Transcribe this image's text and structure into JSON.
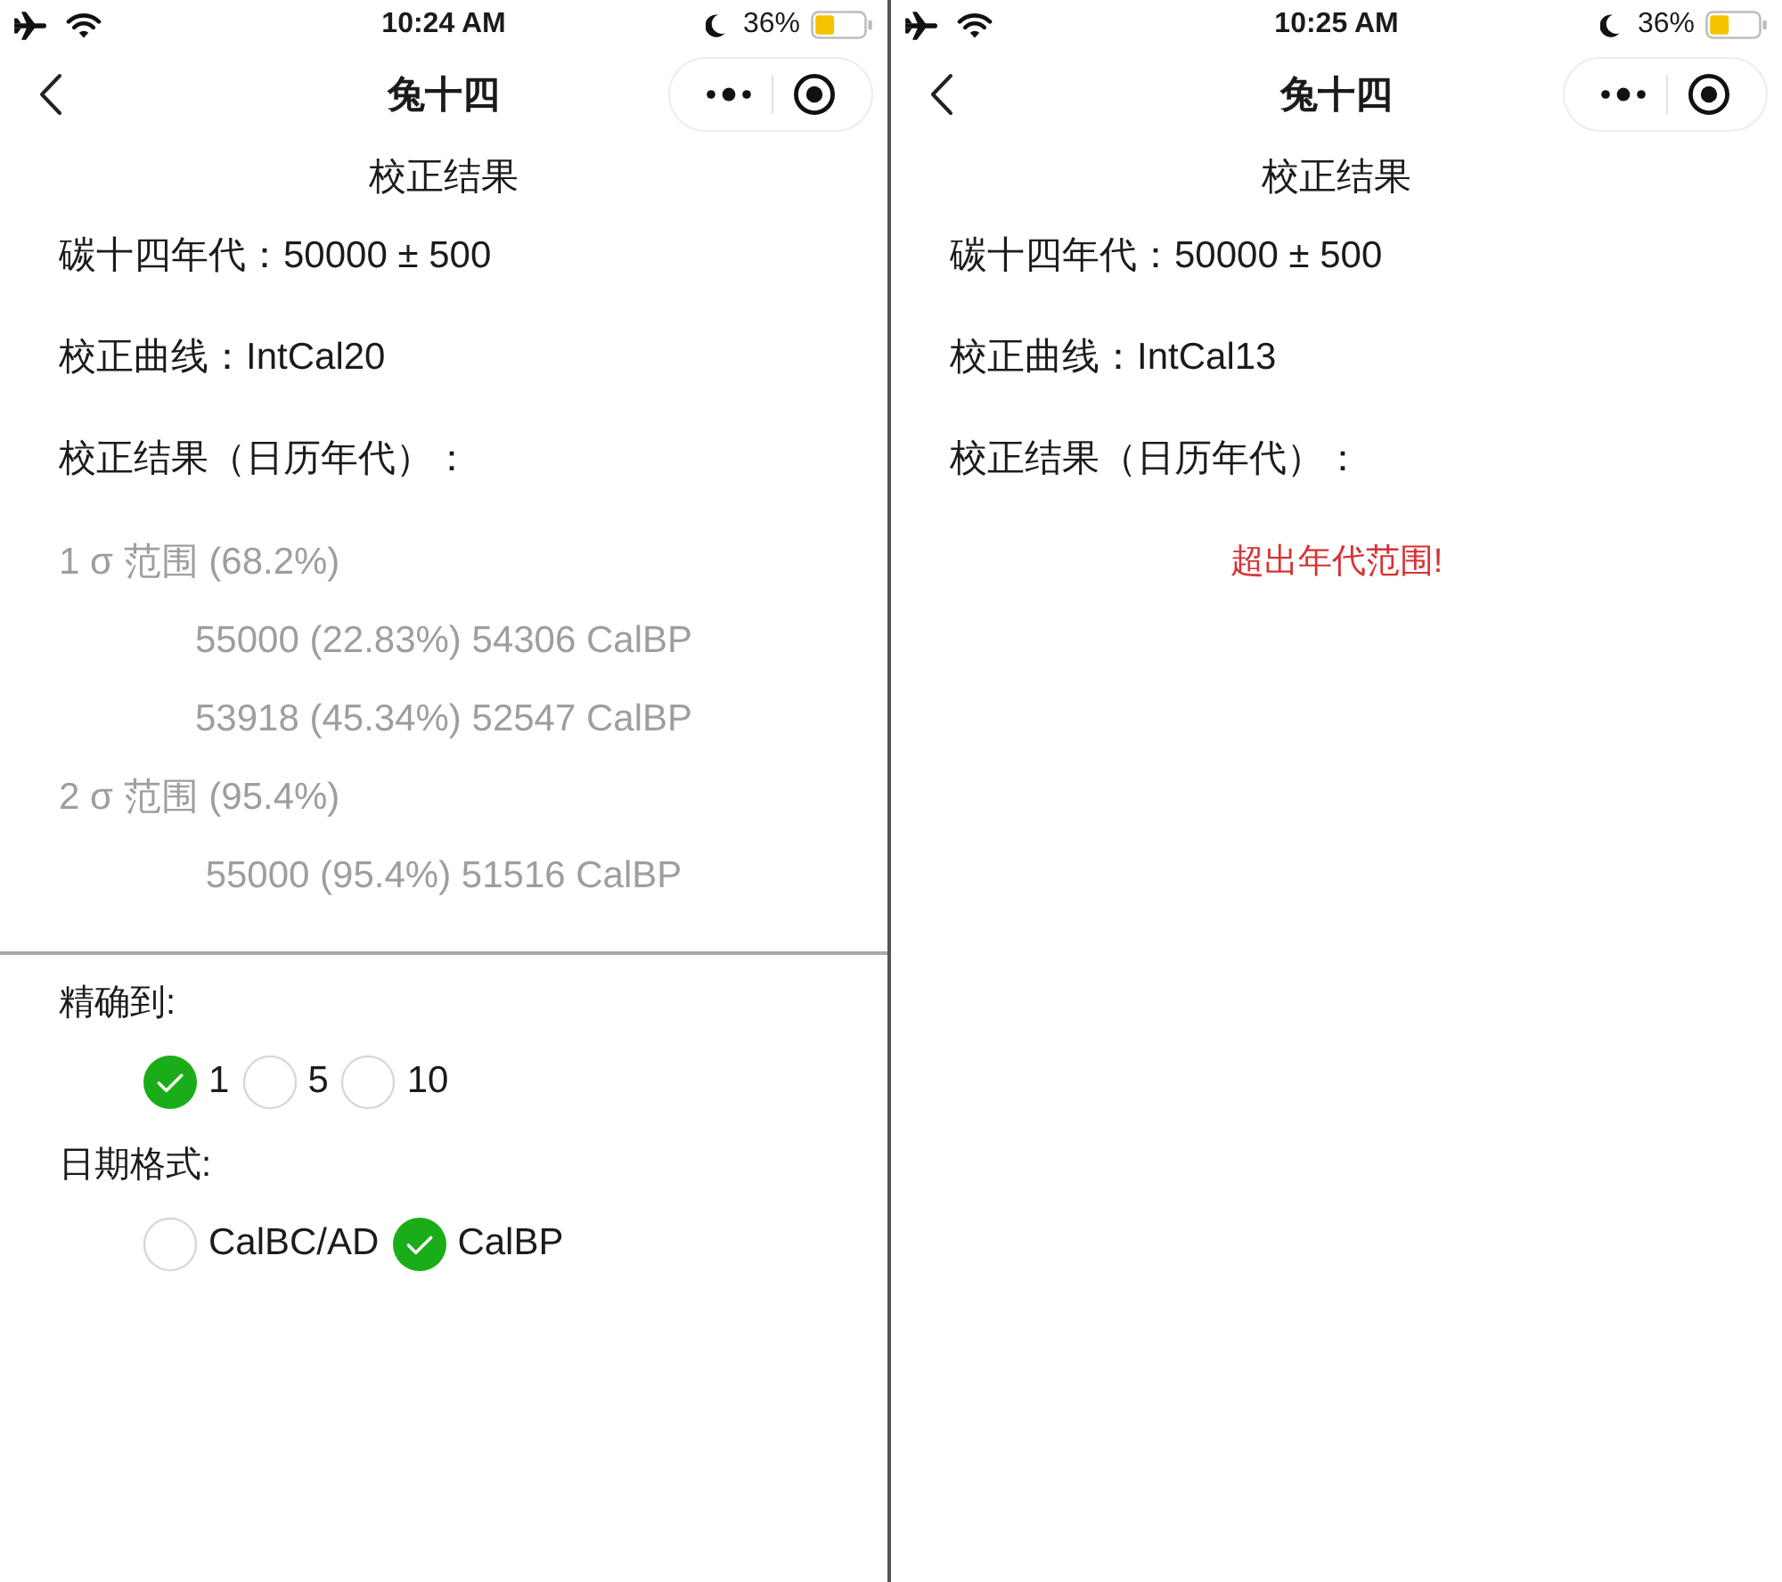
{
  "screens": [
    {
      "status_bar": {
        "time": "10:24 AM",
        "battery": "36%"
      },
      "nav_bar": {
        "title": "兔十四"
      },
      "page_title": "校正结果",
      "info_lines": [
        "碳十四年代：50000 ± 500",
        "校正曲线：IntCal20",
        "校正结果（日历年代）："
      ],
      "results": {
        "kind": "ranges",
        "ranges": [
          {
            "heading": "1 σ 范围 (68.2%)",
            "entries": [
              "55000 (22.83%) 54306 CalBP",
              "53918 (45.34%) 52547 CalBP"
            ]
          },
          {
            "heading": "2 σ 范围 (95.4%)",
            "entries": [
              "55000 (95.4%) 51516 CalBP"
            ]
          }
        ]
      },
      "options": [
        {
          "label": "精确到:",
          "choices": [
            {
              "label": "1",
              "selected": true
            },
            {
              "label": "5",
              "selected": false
            },
            {
              "label": "10",
              "selected": false
            }
          ]
        },
        {
          "label": "日期格式:",
          "choices": [
            {
              "label": "CalBC/AD",
              "selected": false
            },
            {
              "label": "CalBP",
              "selected": true
            }
          ]
        }
      ]
    },
    {
      "status_bar": {
        "time": "10:25 AM",
        "battery": "36%"
      },
      "nav_bar": {
        "title": "兔十四"
      },
      "page_title": "校正结果",
      "info_lines": [
        "碳十四年代：50000 ± 500",
        "校正曲线：IntCal13",
        "校正结果（日历年代）："
      ],
      "results": {
        "kind": "message",
        "message": "超出年代范围!"
      }
    }
  ]
}
